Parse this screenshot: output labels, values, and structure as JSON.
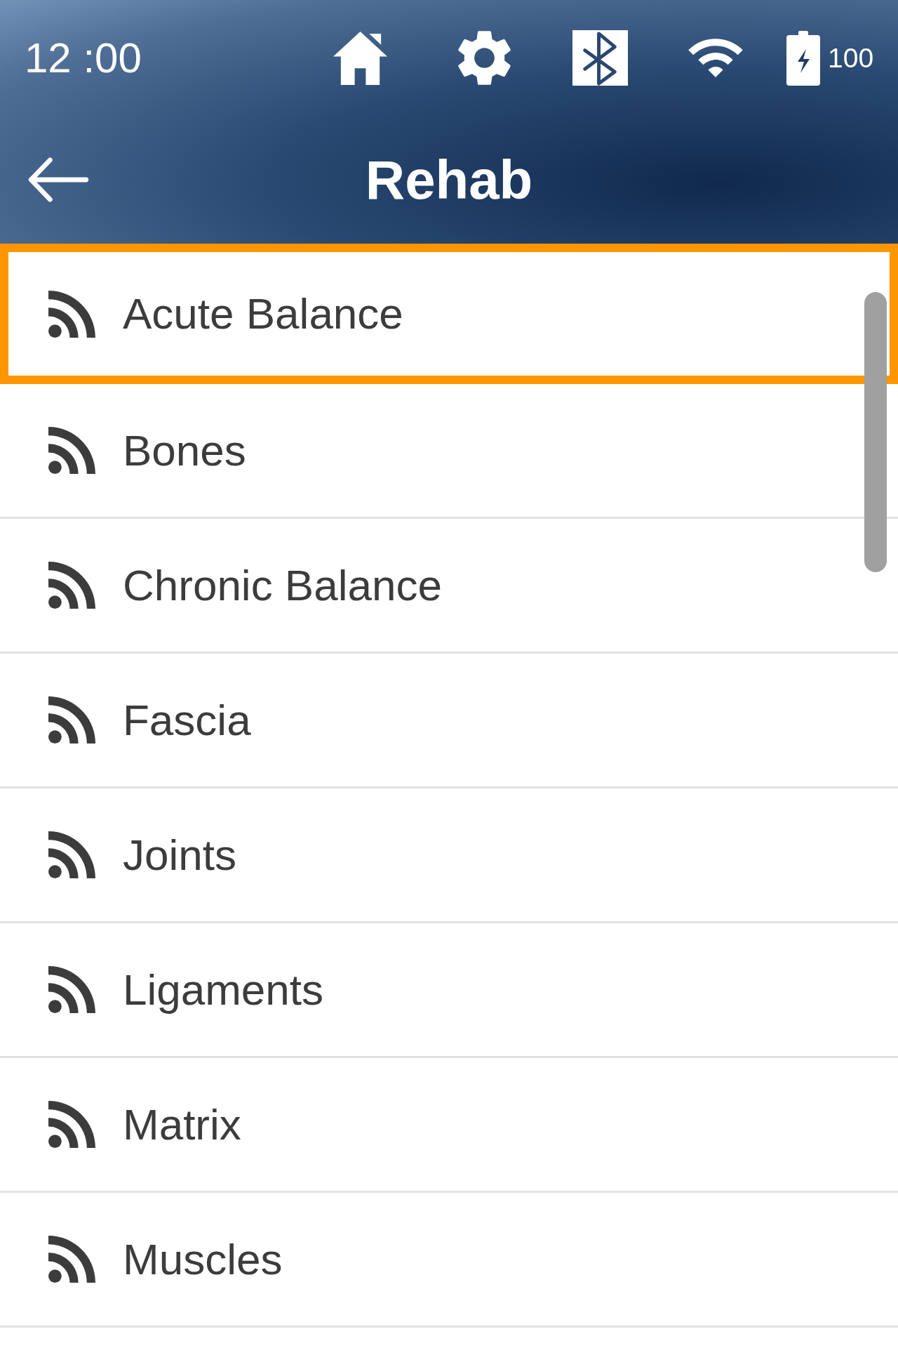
{
  "status_bar": {
    "time": "12 :00",
    "battery": "100"
  },
  "header": {
    "title": "Rehab"
  },
  "list": {
    "items": [
      {
        "label": "Acute Balance",
        "selected": true
      },
      {
        "label": "Bones",
        "selected": false
      },
      {
        "label": "Chronic Balance",
        "selected": false
      },
      {
        "label": "Fascia",
        "selected": false
      },
      {
        "label": "Joints",
        "selected": false
      },
      {
        "label": "Ligaments",
        "selected": false
      },
      {
        "label": "Matrix",
        "selected": false
      },
      {
        "label": "Muscles",
        "selected": false
      }
    ]
  }
}
